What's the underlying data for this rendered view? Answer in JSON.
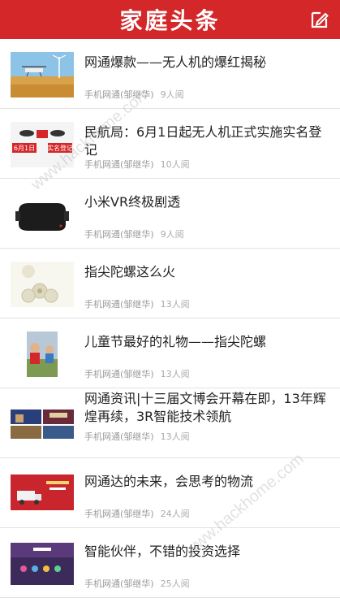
{
  "header": {
    "title": "家庭头条",
    "edit_icon": "edit-icon"
  },
  "articles": [
    {
      "title": "网通爆款——无人机的爆红揭秘",
      "source": "手机网通(邹继华)",
      "reads": "9人阅",
      "thumb": "drone-field-image"
    },
    {
      "title": "民航局：6月1日起无人机正式实施实名登记",
      "source": "手机网通(邹继华)",
      "reads": "10人阅",
      "thumb": "drone-registration-image",
      "thumb_text_left": "6月1日",
      "thumb_text_right": "实名登记"
    },
    {
      "title": "小米VR终极剧透",
      "source": "手机网通(邹继华)",
      "reads": "9人阅",
      "thumb": "vr-headset-image"
    },
    {
      "title": "指尖陀螺这么火",
      "source": "手机网通(邹继华)",
      "reads": "13人阅",
      "thumb": "fidget-spinner-image"
    },
    {
      "title": "儿童节最好的礼物——指尖陀螺",
      "source": "手机网通(邹继华)",
      "reads": "13人阅",
      "thumb": "children-gift-image"
    },
    {
      "title": "网通资讯|十三届文博会开幕在即，13年辉煌再续，3R智能技术领航",
      "source": "手机网通(邹继华)",
      "reads": "13人阅",
      "thumb": "expo-collage-image"
    },
    {
      "title": "网通达的未来，会思考的物流",
      "source": "手机网通(邹继华)",
      "reads": "24人阅",
      "thumb": "logistics-banner-image"
    },
    {
      "title": "智能伙伴，不错的投资选择",
      "source": "手机网通(邹继华)",
      "reads": "25人阅",
      "thumb": "smart-screen-image"
    }
  ],
  "watermark": "www.hackhome.com",
  "colors": {
    "header": "#d3272a",
    "meta": "#999999",
    "divider": "#e3e3e3"
  }
}
